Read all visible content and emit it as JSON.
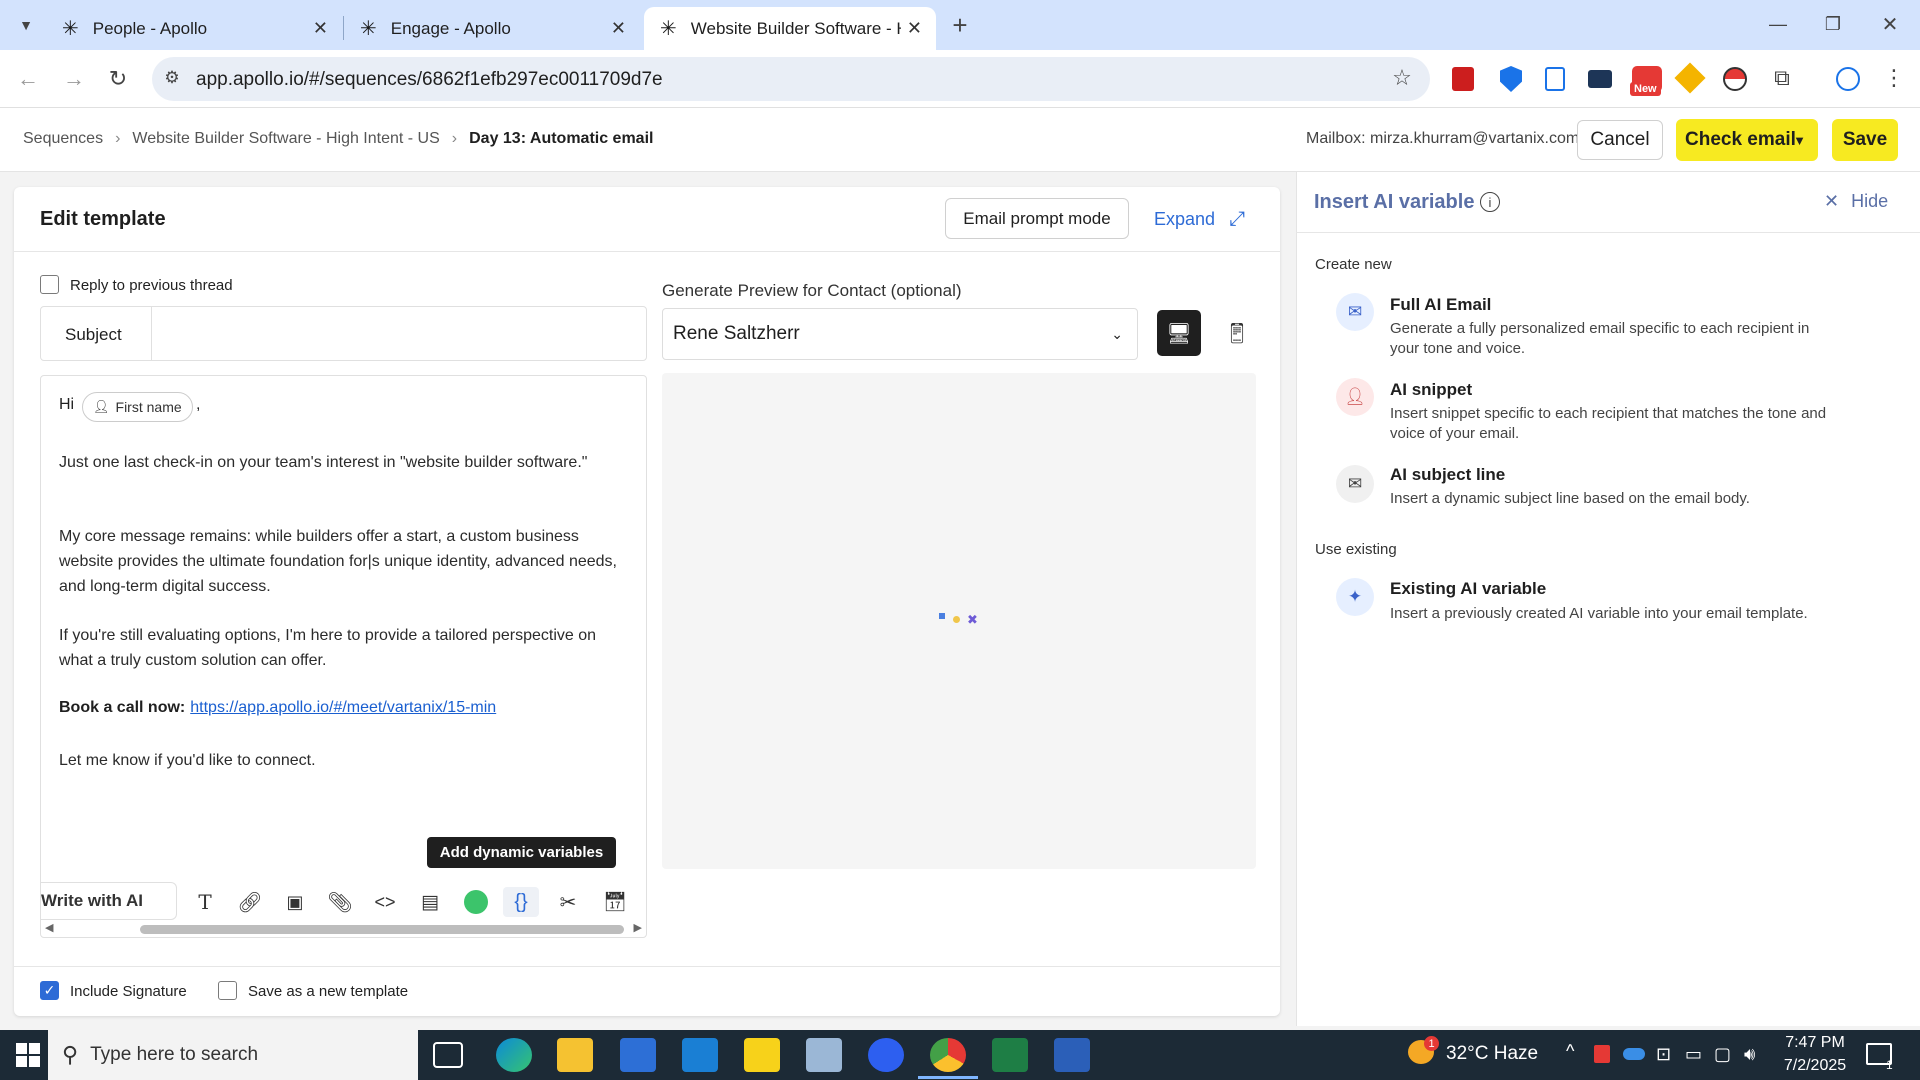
{
  "browser": {
    "tabs": [
      {
        "title": "People - Apollo"
      },
      {
        "title": "Engage - Apollo"
      },
      {
        "title": "Website Builder Software - High"
      }
    ],
    "url": "app.apollo.io/#/sequences/6862f1efb297ec0011709d7e",
    "extension_badge": "New"
  },
  "header": {
    "breadcrumb": [
      "Sequences",
      "Website Builder Software - High Intent - US",
      "Day 13: Automatic email"
    ],
    "mailbox": "Mailbox: mirza.khurram@vartanix.com",
    "cancel_label": "Cancel",
    "check_email_label": "Check email",
    "save_label": "Save"
  },
  "editor": {
    "title": "Edit template",
    "prompt_mode_label": "Email prompt mode",
    "expand_label": "Expand",
    "reply_label": "Reply to previous thread",
    "subject_label": "Subject",
    "greeting": "Hi",
    "first_name_chip": "First name",
    "comma": ",",
    "paragraphs": [
      "Just one last check-in on your team's interest in \"website builder software.\"",
      "My core message remains: while builders offer a start, a custom business website provides the ultimate foundation for|s unique identity, advanced needs, and long-term digital success.",
      "If you're still evaluating options, I'm here to provide a tailored perspective on what a truly custom solution can offer."
    ],
    "cta_label": "Book a call now:",
    "cta_link": "https://app.apollo.io/#/meet/vartanix/15-min",
    "closing": "Let me know if you'd like to connect.",
    "dynamic_vars_tooltip": "Add dynamic variables",
    "write_ai_label": "Write with AI",
    "include_signature": "Include Signature",
    "save_new_template": "Save as a new template"
  },
  "preview": {
    "label": "Generate Preview for Contact (optional)",
    "contact": "Rene Saltzherr"
  },
  "ai_panel": {
    "title": "Insert AI variable",
    "hide_label": "Hide",
    "create_new": "Create new",
    "use_existing": "Use existing",
    "items": [
      {
        "title": "Full AI Email",
        "desc": "Generate a fully personalized email specific to each recipient in your tone and voice."
      },
      {
        "title": "AI snippet",
        "desc": "Insert snippet specific to each recipient that matches the tone and voice of your email."
      },
      {
        "title": "AI subject line",
        "desc": "Insert a dynamic subject line based on the email body."
      },
      {
        "title": "Existing AI variable",
        "desc": "Insert a previously created AI variable into your email template."
      }
    ]
  },
  "taskbar": {
    "search_placeholder": "Type here to search",
    "weather": "32°C Haze",
    "weather_badge": "1",
    "time": "7:47 PM",
    "date": "7/2/2025",
    "notif_count": "1"
  }
}
